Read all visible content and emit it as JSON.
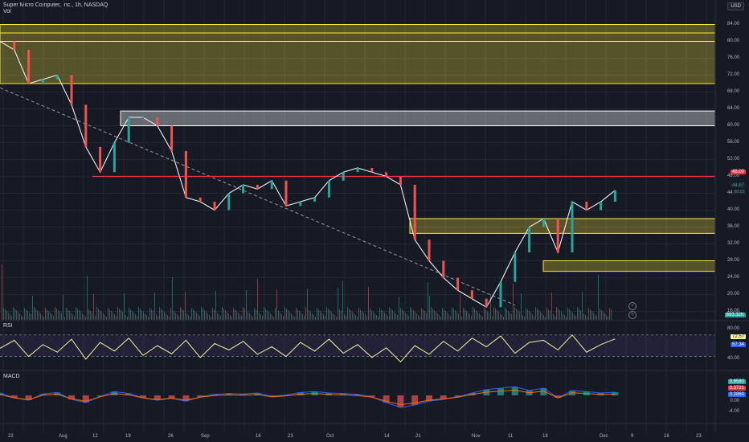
{
  "header": {
    "symbol_line": "Super Micro Computer, Inc., 1h, NASDAQ",
    "vol_label": "Vol",
    "currency_button": "USD"
  },
  "price_axis": {
    "ticks": [
      "84.00",
      "80.00",
      "76.00",
      "72.00",
      "68.00",
      "64.00",
      "60.00",
      "56.00",
      "52.00",
      "48.00",
      "44.00",
      "40.00",
      "36.00",
      "32.00",
      "28.00",
      "24.00",
      "20.00",
      "16.00"
    ],
    "tick_values": [
      84,
      80,
      76,
      72,
      68,
      64,
      60,
      56,
      52,
      48,
      44,
      40,
      36,
      32,
      28,
      24,
      20,
      16
    ],
    "red_line_label": "48.00",
    "last_price_label": "44.67",
    "last_price_sub": "00:23",
    "volume_label": "693.32K"
  },
  "rsi": {
    "label": "RSI",
    "ticks": [
      "80.00",
      "40.00"
    ],
    "value1": "72.57",
    "value2": "57.34"
  },
  "macd": {
    "label": "MACD",
    "ticks": [
      "0.00",
      "-4.00"
    ],
    "value1": "0.6580",
    "value2": "0.3721",
    "value3": "0.2860"
  },
  "time_axis": [
    "22",
    "Aug",
    "12",
    "19",
    "26",
    "Sep",
    "16",
    "23",
    "Oct",
    "14",
    "21",
    "Nov",
    "11",
    "18",
    "Dec",
    "9",
    "16",
    "23"
  ],
  "chart_data": {
    "type": "line",
    "title": "Super Micro Computer, Inc., 1h, NASDAQ",
    "ylim": [
      14,
      86
    ],
    "zones": [
      {
        "from": 70,
        "to": 84,
        "color": "#ffeb3b"
      },
      {
        "from": 60,
        "to": 63.5,
        "color": "#ffffff"
      },
      {
        "from": 34.5,
        "to": 38,
        "color": "#ffeb3b"
      },
      {
        "from": 25.5,
        "to": 28,
        "color": "#ffeb3b"
      }
    ],
    "hlines": [
      {
        "y": 48,
        "color": "#f23645"
      }
    ],
    "trendline": {
      "from": [
        0,
        69
      ],
      "to": [
        0.72,
        17.5
      ]
    },
    "x": [
      0,
      0.02,
      0.04,
      0.06,
      0.08,
      0.1,
      0.12,
      0.14,
      0.16,
      0.18,
      0.2,
      0.22,
      0.24,
      0.26,
      0.28,
      0.3,
      0.32,
      0.34,
      0.36,
      0.38,
      0.4,
      0.42,
      0.44,
      0.46,
      0.48,
      0.5,
      0.52,
      0.54,
      0.56,
      0.58,
      0.6,
      0.62,
      0.64,
      0.66,
      0.68,
      0.7,
      0.72,
      0.74,
      0.76,
      0.78,
      0.8,
      0.82,
      0.84,
      0.86
    ],
    "close": [
      80,
      78,
      70,
      71,
      72,
      65,
      55,
      49,
      56,
      62,
      62,
      60,
      54,
      43,
      42,
      40,
      44,
      46,
      45,
      47,
      41,
      42,
      43,
      47,
      49,
      50,
      49,
      48,
      46,
      33,
      28,
      24,
      21,
      19,
      17,
      23,
      30,
      36,
      38,
      30,
      42,
      40,
      42,
      44.7
    ],
    "rsi": [
      55,
      70,
      40,
      62,
      48,
      72,
      35,
      66,
      50,
      74,
      42,
      60,
      45,
      70,
      38,
      64,
      52,
      68,
      44,
      58,
      40,
      66,
      50,
      72,
      46,
      62,
      38,
      56,
      30,
      60,
      44,
      68,
      50,
      74,
      58,
      78,
      46,
      66,
      70,
      52,
      80,
      48,
      62,
      72.6
    ],
    "macd": [
      0.5,
      -0.5,
      -1,
      0.3,
      0.6,
      -0.8,
      -1.5,
      -0.2,
      0.8,
      0.4,
      -0.5,
      -1,
      -0.6,
      -1.2,
      -0.3,
      0.2,
      0.4,
      0.3,
      0.5,
      -0.2,
      0.1,
      0.6,
      0.8,
      0.5,
      0.4,
      0.2,
      -0.3,
      -1.5,
      -2.5,
      -2,
      -1.2,
      -0.8,
      -0.3,
      0.5,
      1.2,
      1.5,
      1.8,
      1,
      1.5,
      -0.5,
      1,
      0.8,
      0.5,
      0.66
    ]
  },
  "colors": {
    "background": "#161a25",
    "up": "#26a69a",
    "down": "#ef5350",
    "price_line": "#f0f0f0",
    "rsi_line": "#f5f59e",
    "red_level": "#f23645",
    "zone_yellow": "#ffeb3b"
  }
}
